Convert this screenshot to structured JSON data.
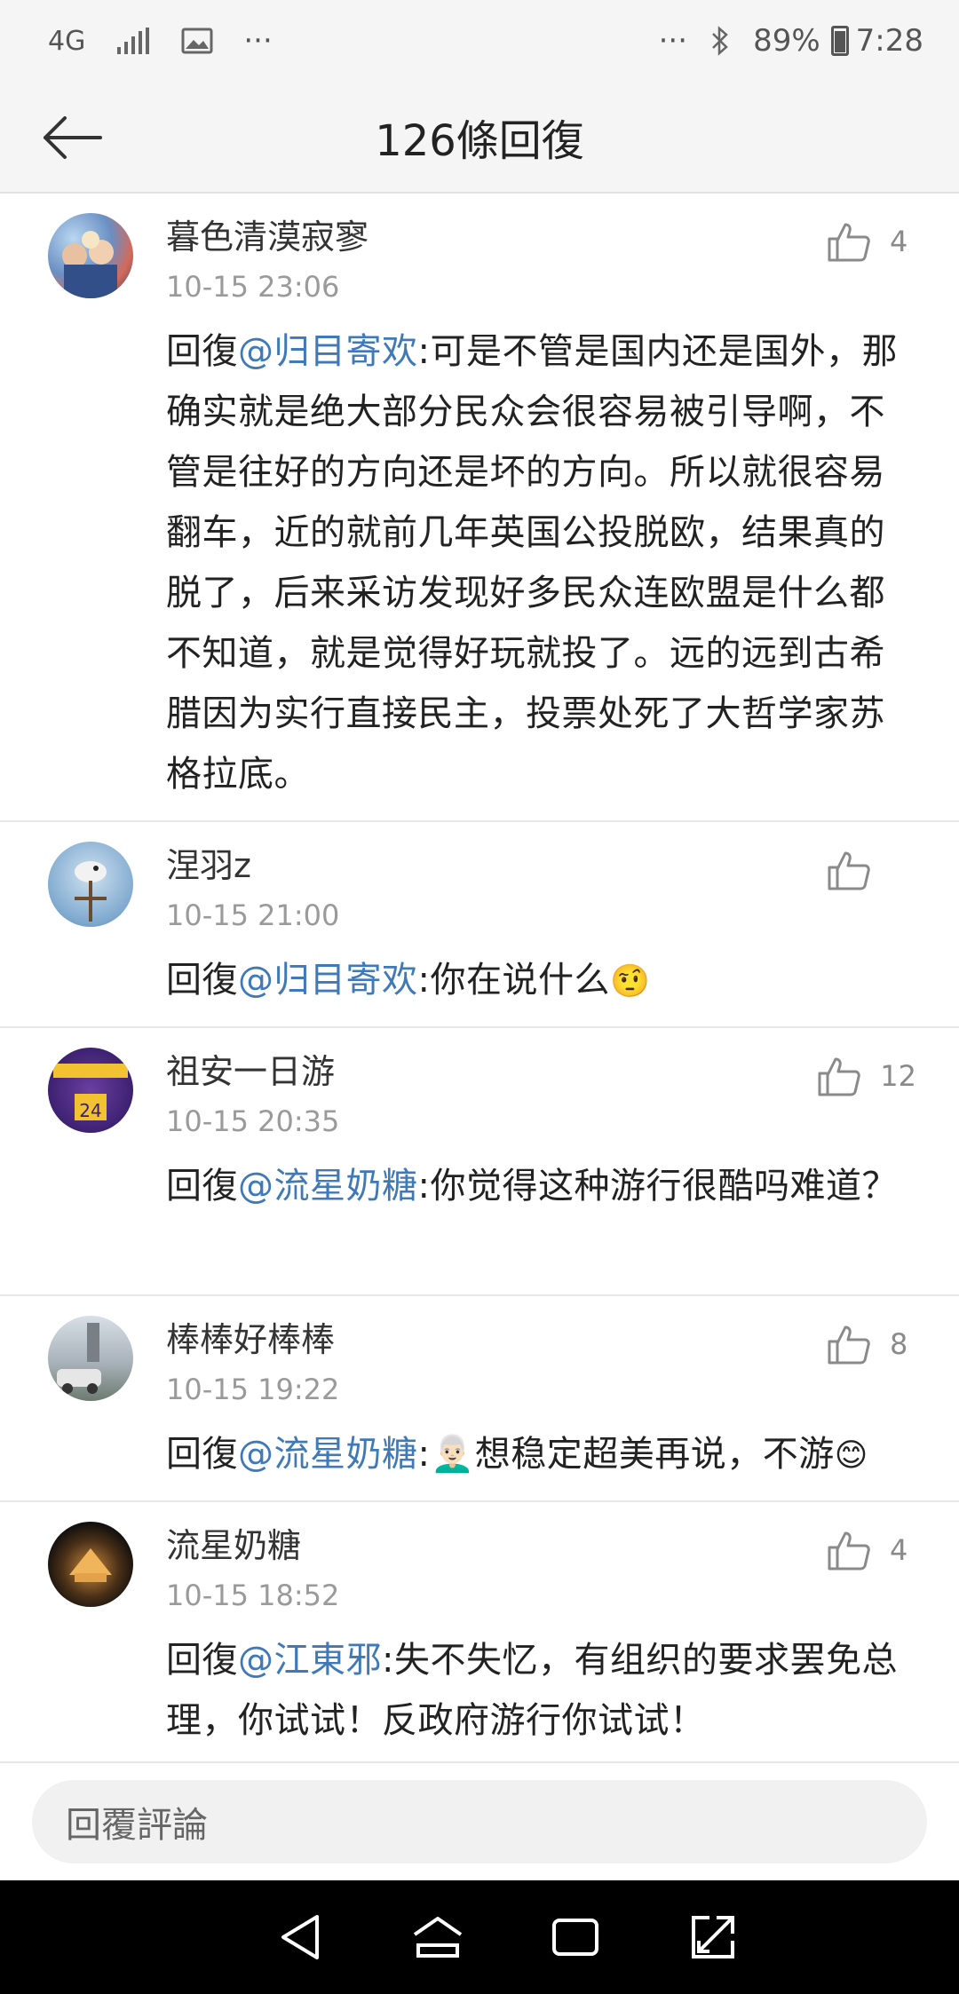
{
  "status_bar": {
    "network": "4G",
    "more_left": "···",
    "more_right": "···",
    "battery": "89%",
    "time": "7:28"
  },
  "header": {
    "title": "126條回復"
  },
  "comments": [
    {
      "username": "暮色清漠寂寥",
      "time": "10-15 23:06",
      "likes": "4",
      "prefix": "回復",
      "mention": "@归目寄欢",
      "text": ":可是不管是国内还是国外，那确实就是绝大部分民众会很容易被引导啊，不管是往好的方向还是坏的方向。所以就很容易翻车，近的就前几年英国公投脱欧，结果真的脱了，后来采访发现好多民众连欧盟是什么都不知道，就是觉得好玩就投了。远的远到古希腊因为实行直接民主，投票处死了大哲学家苏格拉底。",
      "emoji": ""
    },
    {
      "username": "涅羽z",
      "time": "10-15 21:00",
      "likes": "",
      "prefix": "回復",
      "mention": "@归目寄欢",
      "text": ":你在说什么",
      "emoji": "🤨"
    },
    {
      "username": "祖安一日游",
      "time": "10-15 20:35",
      "likes": "12",
      "prefix": "回復",
      "mention": "@流星奶糖",
      "text": ":你觉得这种游行很酷吗难道？",
      "emoji": ""
    },
    {
      "username": "棒棒好棒棒",
      "time": "10-15 19:22",
      "likes": "8",
      "prefix": "回復",
      "mention": "@流星奶糖",
      "text": ":👨🏻‍🦳想稳定超美再说，不游",
      "emoji": "😊"
    },
    {
      "username": "流星奶糖",
      "time": "10-15 18:52",
      "likes": "4",
      "prefix": "回復",
      "mention": "@江東邪",
      "text": ":失不失忆，有组织的要求罢免总理，你试试！反政府游行你试试！",
      "emoji": ""
    }
  ],
  "reply_bar": {
    "placeholder": "回覆評論"
  },
  "colors": {
    "mention": "#3f79b8",
    "secondary": "#9a9a9a",
    "background": "#f5f5f5"
  },
  "icons": {
    "back": "back-arrow-icon",
    "like": "thumbs-up-icon",
    "nav": [
      "back-triangle-icon",
      "home-icon",
      "recents-icon",
      "expand-icon"
    ]
  }
}
